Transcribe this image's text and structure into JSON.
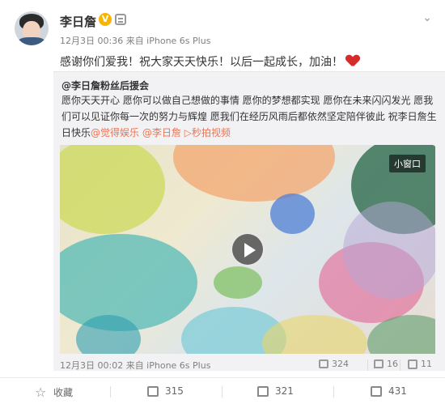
{
  "post": {
    "username": "李日詹",
    "verified_badge": "V",
    "meta": "12月3日 00:36 来自 iPhone 6s Plus",
    "text": "感谢你们爱我！祝大家天天快乐！以后一起成长，加油！",
    "heart_color": "#d42b2b"
  },
  "repost": {
    "orig_user": "@李日詹粉丝后援会",
    "orig_text_main": "愿你天天开心 愿你可以做自己想做的事情 愿你的梦想都实现 愿你在未来闪闪发光 愿我们可以见证你每一次的努力与辉煌 愿我们在经历风雨后都依然坚定陪伴彼此 祝李日詹生日快乐",
    "link_1": "@觉得娱乐",
    "link_2": "@李日詹",
    "video_link": "秒拍视频",
    "mini_window_label": "小窗口",
    "orig_time": "12月3日 00:02 来自 iPhone 6s Plus",
    "orig_repost_count": "324",
    "orig_comment_count": "16",
    "orig_like_count": "11"
  },
  "bottom_bar": {
    "collect_label": "收藏",
    "repost_count": "315",
    "comment_count": "321",
    "like_count": "431"
  },
  "colors": {
    "link": "#eb7350",
    "text": "#333333",
    "meta": "#808080",
    "repost_bg": "#f2f2f5"
  }
}
